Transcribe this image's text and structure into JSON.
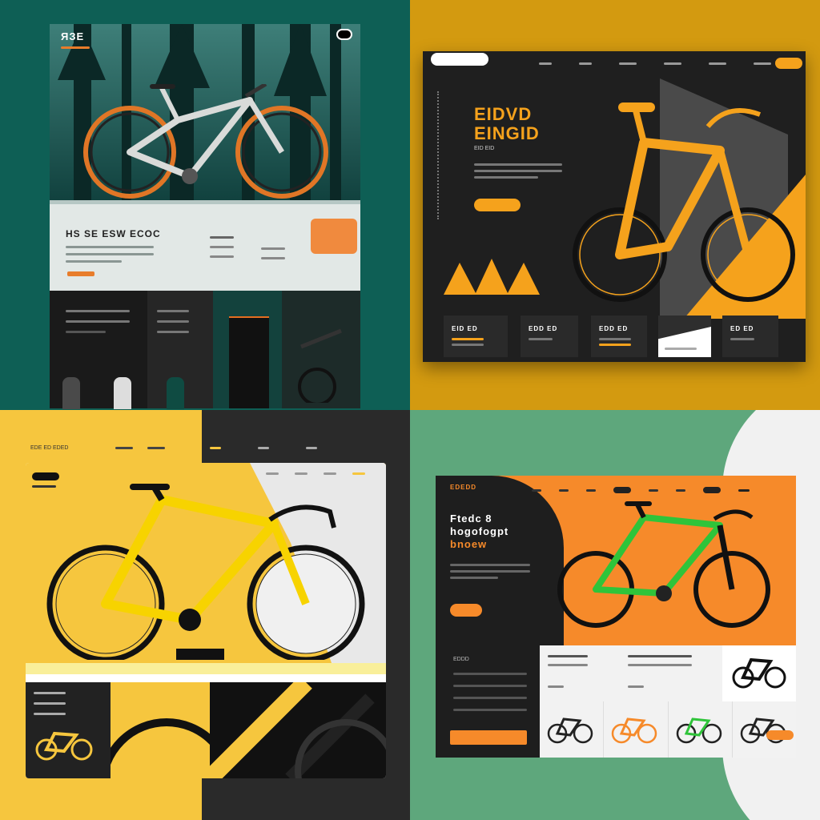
{
  "q1": {
    "logo": "ЯЗЕ",
    "headline": "HS SE ESW ECOC"
  },
  "q2": {
    "title_line1": "EIDVD",
    "title_line2": "EINGID",
    "subtitle": "EID EID",
    "cards": [
      "EID ED",
      "EDD ED",
      "EDD ED",
      "",
      "ED ED"
    ]
  },
  "q3": {
    "top_nav_label": "EDE ED EDED"
  },
  "q4": {
    "logo": "EDEDD",
    "headline_line1": "Ftedc 8",
    "headline_line2": "hogofogpt",
    "headline_line3": "bnoew",
    "list_header": "EDDD"
  }
}
